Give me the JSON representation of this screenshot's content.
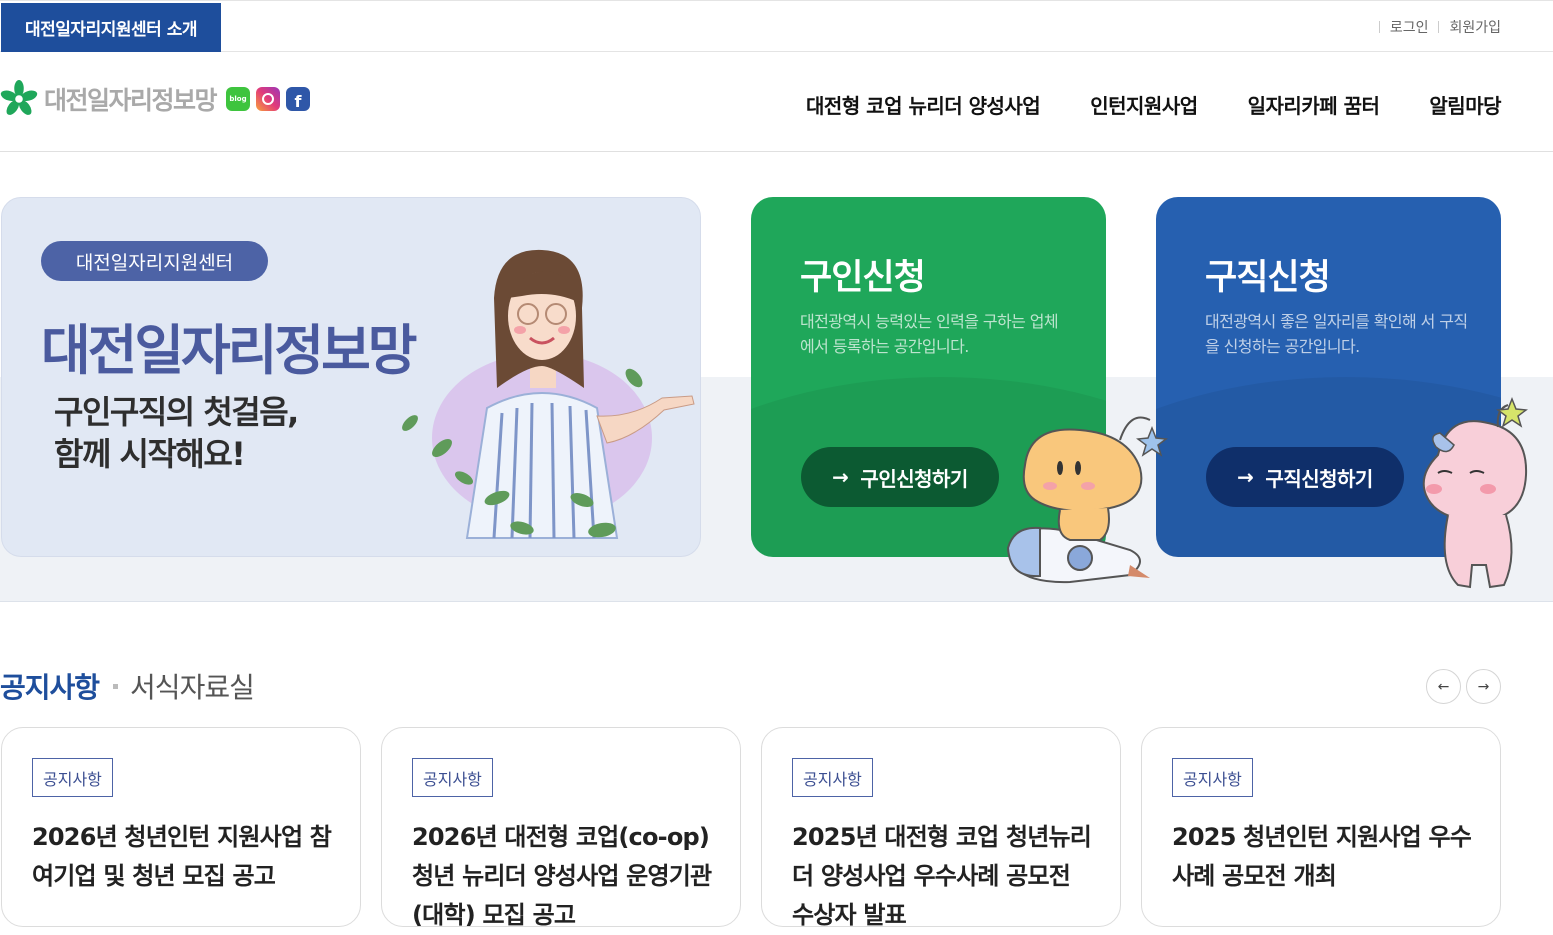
{
  "topbar": {
    "intro_tab": "대전일자리지원센터 소개",
    "login": "로그인",
    "join": "회원가입"
  },
  "header": {
    "logo_text": "대전일자리정보망",
    "blog_label": "blog",
    "nav": [
      "대전형 코업 뉴리더 양성사업",
      "인턴지원사업",
      "일자리카페 꿈터",
      "알림마당"
    ]
  },
  "hero": {
    "pill": "대전일자리지원센터",
    "title": "대전일자리정보망",
    "sub_line1": "구인구직의 첫걸음,",
    "sub_line2": "함께 시작해요!"
  },
  "cards": {
    "employer": {
      "title": "구인신청",
      "desc": "대전광역시 능력있는 인력을 구하는 업체에서 등록하는 공간입니다.",
      "cta": "구인신청하기",
      "color": "#1fa75a"
    },
    "seeker": {
      "title": "구직신청",
      "desc": "대전광역시 좋은 일자리를 확인해 서 구직을 신청하는 공간입니다.",
      "cta": "구직신청하기",
      "color": "#2660b0"
    }
  },
  "notices": {
    "tab_active": "공지사항",
    "tab_inactive": "서식자료실",
    "items": [
      {
        "tag": "공지사항",
        "title": "2026년 청년인턴 지원사업 참여기업 및 청년 모집 공고"
      },
      {
        "tag": "공지사항",
        "title": "2026년 대전형 코업(co-op) 청년 뉴리더 양성사업 운영기관(대학) 모집 공고"
      },
      {
        "tag": "공지사항",
        "title": "2025년 대전형 코업 청년뉴리더 양성사업 우수사례 공모전 수상자 발표"
      },
      {
        "tag": "공지사항",
        "title": "2025 청년인턴 지원사업 우수사례 공모전 개최"
      }
    ]
  }
}
